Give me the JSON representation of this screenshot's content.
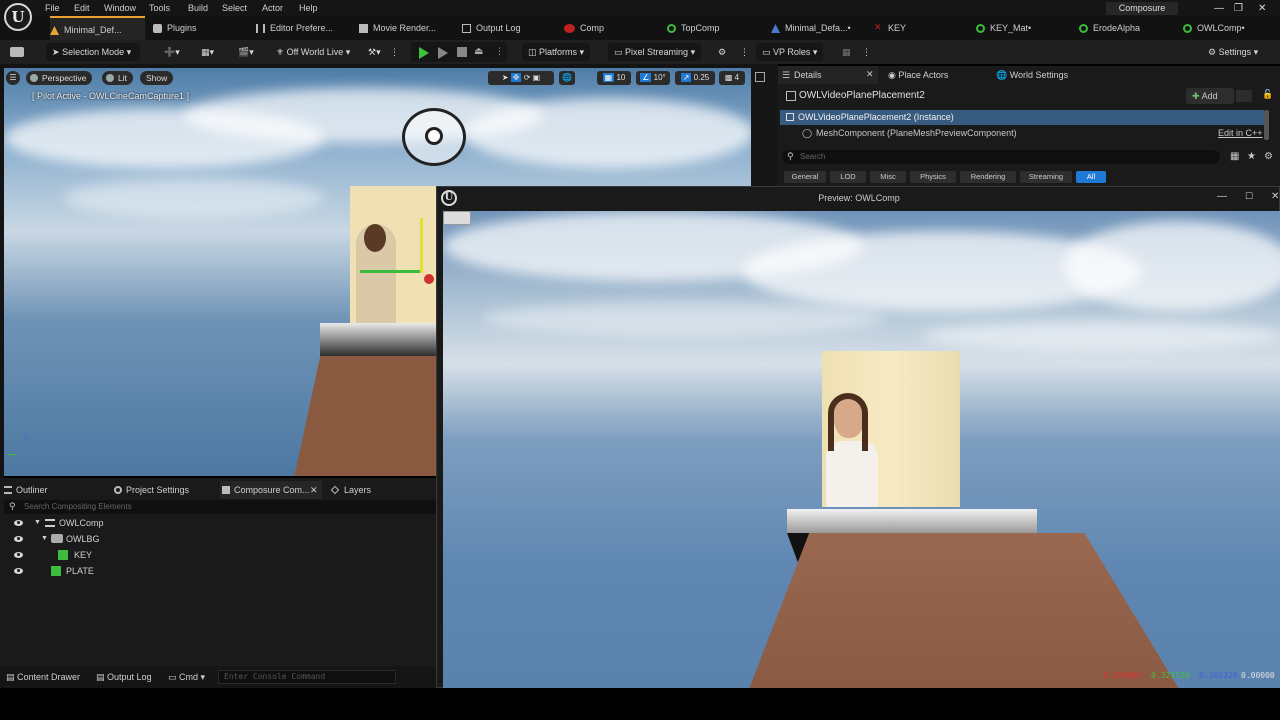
{
  "app": {
    "logo_glyph": "U",
    "window_title": "Composure",
    "accent_color": "#f0a030"
  },
  "menu": [
    "File",
    "Edit",
    "Window",
    "Tools",
    "Build",
    "Select",
    "Actor",
    "Help"
  ],
  "tabs": [
    {
      "label": "Minimal_Def...",
      "icon": "level-icon",
      "color": "#e8a33a",
      "active": true
    },
    {
      "label": "Plugins",
      "icon": "plugin-icon",
      "color": "#bbbbbb"
    },
    {
      "label": "Editor Prefere...",
      "icon": "sliders-icon",
      "color": "#bbbbbb"
    },
    {
      "label": "Movie Render...",
      "icon": "clapper-icon",
      "color": "#bbbbbb"
    },
    {
      "label": "Output Log",
      "icon": "log-icon",
      "color": "#bbbbbb"
    },
    {
      "label": "Comp",
      "icon": "comp-icon",
      "color": "#c02020"
    },
    {
      "label": "TopComp",
      "icon": "comp-icon",
      "color": "#3dbb3d"
    },
    {
      "label": "Minimal_Defa...•",
      "icon": "level-icon",
      "color": "#4a7ad0"
    },
    {
      "label": "KEY",
      "icon": "x-icon",
      "color": "#c02020"
    },
    {
      "label": "KEY_Mat•",
      "icon": "material-icon",
      "color": "#3dbb3d"
    },
    {
      "label": "ErodeAlpha",
      "icon": "material-icon",
      "color": "#3dbb3d"
    },
    {
      "label": "OWLComp•",
      "icon": "comp-icon",
      "color": "#3dbb3d"
    }
  ],
  "toolbar": {
    "selection_mode": "Selection Mode",
    "world": "Off World Live",
    "platforms": "Platforms",
    "pixel_streaming": "Pixel Streaming",
    "vp_roles": "VP Roles",
    "settings": "Settings"
  },
  "viewport": {
    "perspective": "Perspective",
    "lit": "Lit",
    "show": "Show",
    "pilot_label": "[ Pilot Active - OWLCineCamCapture1 ]",
    "grid_snap": "10",
    "rotation_snap": "10°",
    "scale_snap": "0.25",
    "camera_speed": "4",
    "axis_z": "Z"
  },
  "details": {
    "tabs": [
      "Details",
      "Place Actors",
      "World Settings"
    ],
    "actor_name": "OWLVideoPlanePlacement2",
    "add_label": "Add",
    "instance_row": "OWLVideoPlanePlacement2 (Instance)",
    "component_row": "MeshComponent (PlaneMeshPreviewComponent)",
    "edit_cpp": "Edit in C++",
    "search_placeholder": "Search",
    "filters": [
      "General",
      "LOD",
      "Misc",
      "Physics",
      "Rendering",
      "Streaming",
      "All"
    ]
  },
  "preview": {
    "title": "Preview: OWLComp",
    "readout_r": "0.560963",
    "readout_g": "0.321530",
    "readout_b": "0.361320",
    "readout_a": "0.00000"
  },
  "comp_panel": {
    "tabs": [
      "Outliner",
      "Project Settings",
      "Composure Com...",
      "Layers"
    ],
    "search_placeholder": "Search Compositing Elements",
    "tree": [
      {
        "label": "OWLComp",
        "depth": 0,
        "icon": "stack-icon"
      },
      {
        "label": "OWLBG",
        "depth": 1,
        "icon": "camera-icon"
      },
      {
        "label": "KEY",
        "depth": 2,
        "icon": "layer-icon"
      },
      {
        "label": "PLATE",
        "depth": 1,
        "icon": "layer-icon"
      }
    ]
  },
  "statusbar": {
    "content_drawer": "Content Drawer",
    "output_log": "Output Log",
    "cmd": "Cmd",
    "console_placeholder": "Enter Console Command"
  }
}
